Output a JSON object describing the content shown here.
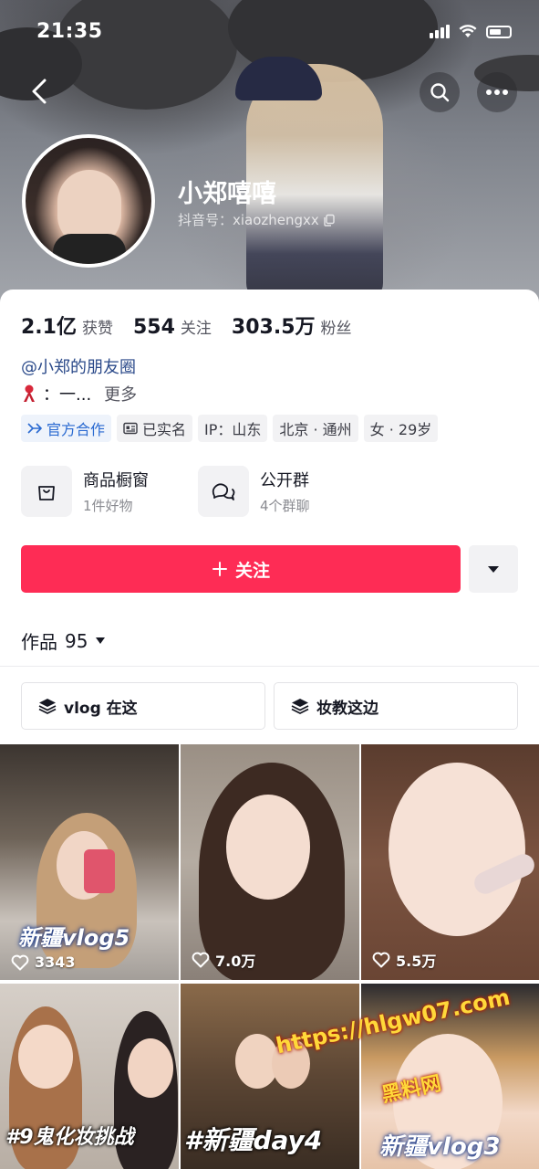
{
  "status_bar": {
    "time": "21:35"
  },
  "profile": {
    "nickname": "小郑嘻嘻",
    "douyin_id": "抖音号：xiaozhengxx"
  },
  "stats": [
    {
      "value": "2.1亿",
      "label": "获赞"
    },
    {
      "value": "554",
      "label": "关注"
    },
    {
      "value": "303.5万",
      "label": "粉丝"
    }
  ],
  "friend_circle": "@小郑的朋友圈",
  "bio": {
    "text": "：一...",
    "more": "更多"
  },
  "tags": [
    {
      "label": "官方合作",
      "icon": "official-icon"
    },
    {
      "label": "已实名",
      "icon": "id-card-icon"
    },
    {
      "label": "IP：山东"
    },
    {
      "label": "北京 · 通州"
    },
    {
      "label": "女 · 29岁"
    }
  ],
  "shortcuts": [
    {
      "title": "商品橱窗",
      "subtitle": "1件好物",
      "icon": "shopping-bag-icon"
    },
    {
      "title": "公开群",
      "subtitle": "4个群聊",
      "icon": "chat-bubbles-icon"
    }
  ],
  "follow_button": {
    "label": "关注",
    "icon": "plus-icon"
  },
  "works_tab": {
    "label": "作品",
    "count": "95"
  },
  "collections": [
    {
      "label": "vlog 在这",
      "icon": "layers-icon"
    },
    {
      "label": "妆教这边",
      "icon": "layers-icon"
    }
  ],
  "videos": [
    {
      "likes": "3343",
      "caption": "新疆vlog5"
    },
    {
      "likes": "7.0万",
      "caption": ""
    },
    {
      "likes": "5.5万",
      "caption": ""
    },
    {
      "likes": "",
      "caption": "#9鬼化妆挑战"
    },
    {
      "likes": "",
      "caption": "#新疆day4"
    },
    {
      "likes": "",
      "caption": "新疆vlog3"
    }
  ],
  "watermark": {
    "url": "https://hlgw07.com",
    "label": "黑料网"
  },
  "colors": {
    "accent": "#fe2c55",
    "link": "#2b4a8a",
    "official_blue": "#2a6ad1"
  }
}
